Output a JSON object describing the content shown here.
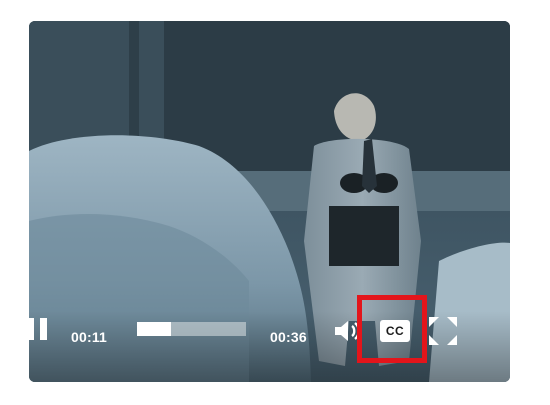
{
  "player": {
    "current_time": "00:11",
    "total_time": "00:36",
    "progress_fraction": 0.31,
    "cc_label": "CC",
    "highlighted_control": "cc-button"
  },
  "icons": {
    "play_pause": "pause-icon",
    "volume": "speaker-icon",
    "fullscreen": "fullscreen-icon"
  },
  "colors": {
    "highlight": "#e3151b",
    "controls": "#ffffff",
    "progress_track": "#c8ced2"
  }
}
